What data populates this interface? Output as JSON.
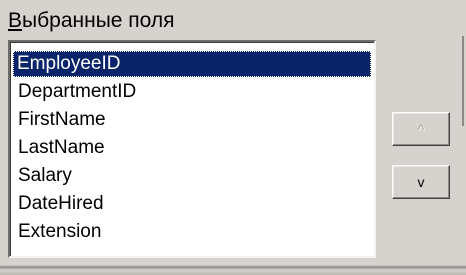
{
  "fields_section": {
    "label_accel": "В",
    "label_rest": "ыбранные поля"
  },
  "selected_fields": {
    "items": [
      {
        "label": "EmployeeID",
        "selected": true
      },
      {
        "label": "DepartmentID",
        "selected": false
      },
      {
        "label": "FirstName",
        "selected": false
      },
      {
        "label": "LastName",
        "selected": false
      },
      {
        "label": "Salary",
        "selected": false
      },
      {
        "label": "DateHired",
        "selected": false
      },
      {
        "label": "Extension",
        "selected": false
      }
    ]
  },
  "buttons": {
    "move_up": {
      "glyph": "^",
      "enabled": false
    },
    "move_down": {
      "glyph": "v",
      "enabled": true
    }
  }
}
